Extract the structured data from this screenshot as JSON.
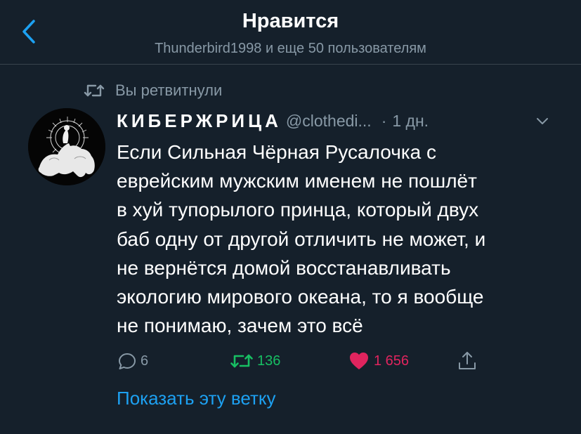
{
  "header": {
    "title": "Нравится",
    "subtitle": "Thunderbird1998 и еще 50 пользователям"
  },
  "context": {
    "retweet_text": "Вы ретвитнули"
  },
  "tweet": {
    "author_name": "КИБЕРЖРИЦА",
    "handle": "@clothedi...",
    "dot": "·",
    "time": "1 дн.",
    "text_lines": [
      "Если Сильная Чёрная Русалочка с",
      "еврейским мужским именем не пошлёт",
      "в хуй тупорылого принца, который двух",
      "баб одну от другой отличить не может, и",
      "не вернётся домой восстанавливать",
      "экологию мирового океана, то я вообще",
      "не понимаю, зачем это всё"
    ],
    "reply_count": "6",
    "retweet_count": "136",
    "like_count": "1 656",
    "show_thread": "Показать эту ветку"
  },
  "colors": {
    "background": "#15202b",
    "secondary_text": "#8899a6",
    "accent_blue": "#1da1f2",
    "retweet_green": "#17bf63",
    "like_red": "#e0245e",
    "divider": "#38444d"
  },
  "icons": {
    "back": "chevron-left-icon",
    "retweet": "retweet-icon",
    "caret": "chevron-down-icon",
    "reply": "reply-icon",
    "like": "heart-icon",
    "share": "share-icon"
  }
}
